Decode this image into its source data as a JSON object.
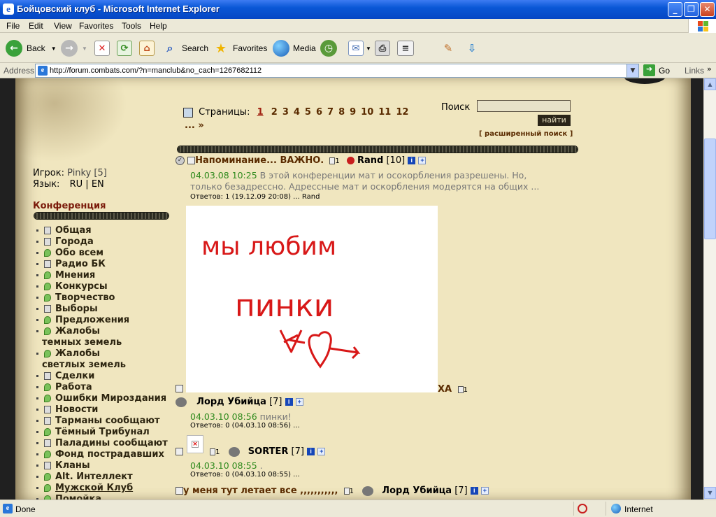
{
  "window": {
    "title": "Бойцовский клуб - Microsoft Internet Explorer"
  },
  "menu": [
    "File",
    "Edit",
    "View",
    "Favorites",
    "Tools",
    "Help"
  ],
  "toolbar": {
    "back": "Back",
    "search": "Search",
    "favorites": "Favorites",
    "media": "Media"
  },
  "address": {
    "label": "Address",
    "url": "http://forum.combats.com/?n=manclub&no_cach=1267682112",
    "go": "Go",
    "links": "Links"
  },
  "sidebar": {
    "player_label": "Игрок:",
    "player_value": "Pinky [5]",
    "lang_label": "Язык:",
    "lang_ru": "RU",
    "lang_sep": "|",
    "lang_en": "EN",
    "conf_heading": "Конференция",
    "items": [
      {
        "label": "Общая",
        "icon": "doc"
      },
      {
        "label": "Города",
        "icon": "doc"
      },
      {
        "label": "Обо всем",
        "icon": "chat"
      },
      {
        "label": "Радио БК",
        "icon": "doc"
      },
      {
        "label": "Мнения",
        "icon": "chat"
      },
      {
        "label": "Конкурсы",
        "icon": "chat"
      },
      {
        "label": "Творчество",
        "icon": "chat"
      },
      {
        "label": "Выборы",
        "icon": "doc"
      },
      {
        "label": "Предложения",
        "icon": "chat"
      },
      {
        "label": "Жалобы",
        "label2": "темных земель",
        "icon": "chat"
      },
      {
        "label": "Жалобы",
        "label2": "светлых земель",
        "icon": "chat"
      },
      {
        "label": "Сделки",
        "icon": "doc"
      },
      {
        "label": "Работа",
        "icon": "chat"
      },
      {
        "label": "Ошибки Мироздания",
        "icon": "chat"
      },
      {
        "label": "Новости",
        "icon": "doc"
      },
      {
        "label": "Тарманы сообщают",
        "icon": "doc"
      },
      {
        "label": "Тёмный Трибунал",
        "icon": "chat"
      },
      {
        "label": "Паладины сообщают",
        "icon": "doc"
      },
      {
        "label": "Фонд пострадавших",
        "icon": "chat"
      },
      {
        "label": "Кланы",
        "icon": "doc"
      },
      {
        "label": "Alt. Интеллект",
        "icon": "chat"
      },
      {
        "label": "Мужской Клуб",
        "icon": "chat",
        "active": true
      },
      {
        "label": "Помойка",
        "icon": "chat"
      }
    ]
  },
  "pager": {
    "label": "Страницы:",
    "current": "1",
    "pages": [
      "2",
      "3",
      "4",
      "5",
      "6",
      "7",
      "8",
      "9",
      "10",
      "11",
      "12"
    ],
    "more": "... »"
  },
  "search": {
    "label": "Поиск",
    "value": "",
    "button": "найти",
    "advanced": "[ расширенный поиск ]"
  },
  "topics": [
    {
      "title": "Напоминание... ВАЖНО.",
      "count": "1",
      "author": "Rand",
      "level": "[10]",
      "date": "04.03.08 10:25",
      "text1": "В этой конференции мат и осокорбления разрешены. Но,",
      "text2": "только безадрессно. Адрессные мат и оскорбления модерятся на общих ...",
      "replies": "Ответов: 1  (19.12.09 20:08) ... Rand"
    },
    {
      "title_tail": "ХА",
      "count": "1",
      "author": "Лорд Убийца",
      "level": "[7]",
      "date": "04.03.10 08:56",
      "text1": "пинки!",
      "replies": "Ответов: 0  (04.03.10 08:56) ..."
    },
    {
      "count": "1",
      "author": "SORTER",
      "level": "[7]",
      "date": "04.03.10 08:55",
      "text1": ".",
      "replies": "Ответов: 0  (04.03.10 08:55) ..."
    },
    {
      "title": "у меня тут летает все ,,,,,,,,,,,",
      "count": "1",
      "author": "Лорд Убийца",
      "level": "[7]"
    }
  ],
  "drawing": {
    "line1": "мы любим",
    "line2": "пинки"
  },
  "status": {
    "left": "Done",
    "zone": "Internet"
  }
}
